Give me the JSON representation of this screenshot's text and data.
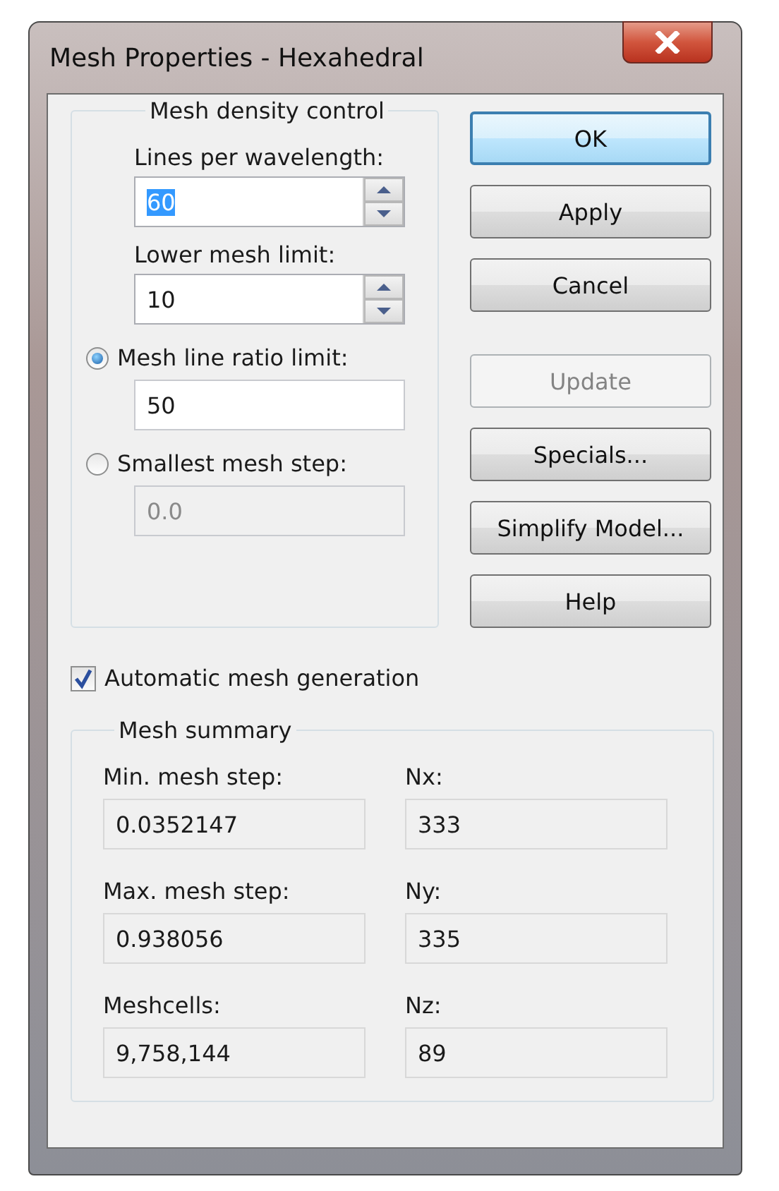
{
  "window": {
    "title": "Mesh Properties - Hexahedral"
  },
  "density": {
    "title": "Mesh density control",
    "items": [
      {
        "kind": "spin",
        "label": "Lines per wavelength:",
        "value": "60",
        "text_selected": true
      },
      {
        "kind": "spin",
        "label": "Lower mesh limit:",
        "value": "10",
        "text_selected": false
      },
      {
        "kind": "radio",
        "label": "Mesh line ratio limit:",
        "selected": true,
        "value": "50",
        "disabled": false
      },
      {
        "kind": "radio",
        "label": "Smallest mesh step:",
        "selected": false,
        "value": "0.0",
        "disabled": true
      }
    ]
  },
  "buttons": [
    {
      "label": "OK",
      "default": true,
      "disabled": false
    },
    {
      "label": "Apply",
      "default": false,
      "disabled": false
    },
    {
      "label": "Cancel",
      "default": false,
      "disabled": false
    },
    {
      "label": "Update",
      "default": false,
      "disabled": true
    },
    {
      "label": "Specials...",
      "default": false,
      "disabled": false
    },
    {
      "label": "Simplify Model...",
      "default": false,
      "disabled": false
    },
    {
      "label": "Help",
      "default": false,
      "disabled": false
    }
  ],
  "auto_mesh": {
    "label": "Automatic mesh generation",
    "checked": true
  },
  "summary": {
    "title": "Mesh summary",
    "fields": [
      {
        "label": "Min. mesh step:",
        "value": "0.0352147"
      },
      {
        "label": "Nx:",
        "value": "333"
      },
      {
        "label": "Max. mesh step:",
        "value": "0.938056"
      },
      {
        "label": "Ny:",
        "value": "335"
      },
      {
        "label": "Meshcells:",
        "value": "9,758,144"
      },
      {
        "label": "Nz:",
        "value": "89"
      }
    ]
  }
}
